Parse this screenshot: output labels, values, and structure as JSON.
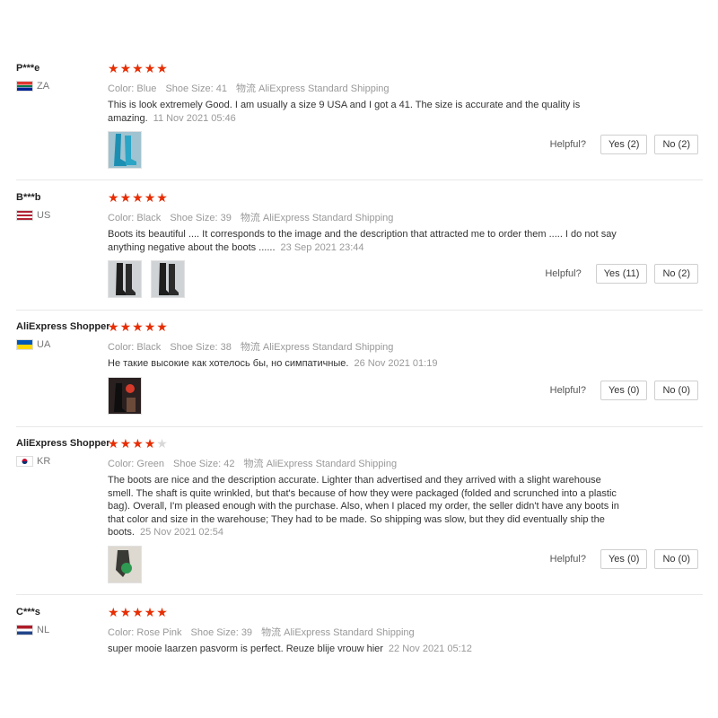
{
  "labels": {
    "color": "Color:",
    "shoe_size": "Shoe Size:",
    "shipping_key": "物流",
    "helpful": "Helpful?"
  },
  "reviews": [
    {
      "user": "P***e",
      "country": "ZA",
      "rating": 5,
      "color": "Blue",
      "shoe_size": "41",
      "shipping": "AliExpress Standard Shipping",
      "text": "This is look extremely Good. I am usually a size 9 USA and I got a 41. The size is accurate and the quality is amazing.",
      "date": "11 Nov 2021 05:46",
      "photos": [
        "blue-boots-photo"
      ],
      "yes": "Yes (2)",
      "no": "No (2)"
    },
    {
      "user": "B***b",
      "country": "US",
      "rating": 5,
      "color": "Black",
      "shoe_size": "39",
      "shipping": "AliExpress Standard Shipping",
      "text": "Boots its beautiful .... It corresponds to the image and the description that attracted me to order them ..... I do not say anything negative about the boots ......",
      "date": "23 Sep 2021 23:44",
      "photos": [
        "black-boots-photo",
        "black-boots-photo"
      ],
      "yes": "Yes (11)",
      "no": "No (2)"
    },
    {
      "user": "AliExpress Shopper",
      "country": "UA",
      "rating": 5,
      "color": "Black",
      "shoe_size": "38",
      "shipping": "AliExpress Standard Shipping",
      "text": "Не такие высокие как хотелось бы, но симпатичные.",
      "date": "26 Nov 2021 01:19",
      "photos": [
        "boots-photo"
      ],
      "yes": "Yes (0)",
      "no": "No (0)"
    },
    {
      "user": "AliExpress Shopper",
      "country": "KR",
      "rating": 4,
      "color": "Green",
      "shoe_size": "42",
      "shipping": "AliExpress Standard Shipping",
      "text": "The boots are nice and the description accurate. Lighter than advertised and they arrived with a slight warehouse smell. The shaft is quite wrinkled, but that's because of how they were packaged (folded and scrunched into a plastic bag). Overall, I'm pleased enough with the purchase. Also, when I placed my order, the seller didn't have any boots in that color and size in the warehouse; They had to be made. So shipping was slow, but they did eventually ship the boots.",
      "date": "25 Nov 2021 02:54",
      "photos": [
        "green-boots-photo"
      ],
      "yes": "Yes (0)",
      "no": "No (0)"
    },
    {
      "user": "C***s",
      "country": "NL",
      "rating": 5,
      "color": "Rose Pink",
      "shoe_size": "39",
      "shipping": "AliExpress Standard Shipping",
      "text": "super mooie laarzen pasvorm is perfect. Reuze blije vrouw hier",
      "date": "22 Nov 2021 05:12",
      "photos": [],
      "yes": "",
      "no": ""
    }
  ]
}
